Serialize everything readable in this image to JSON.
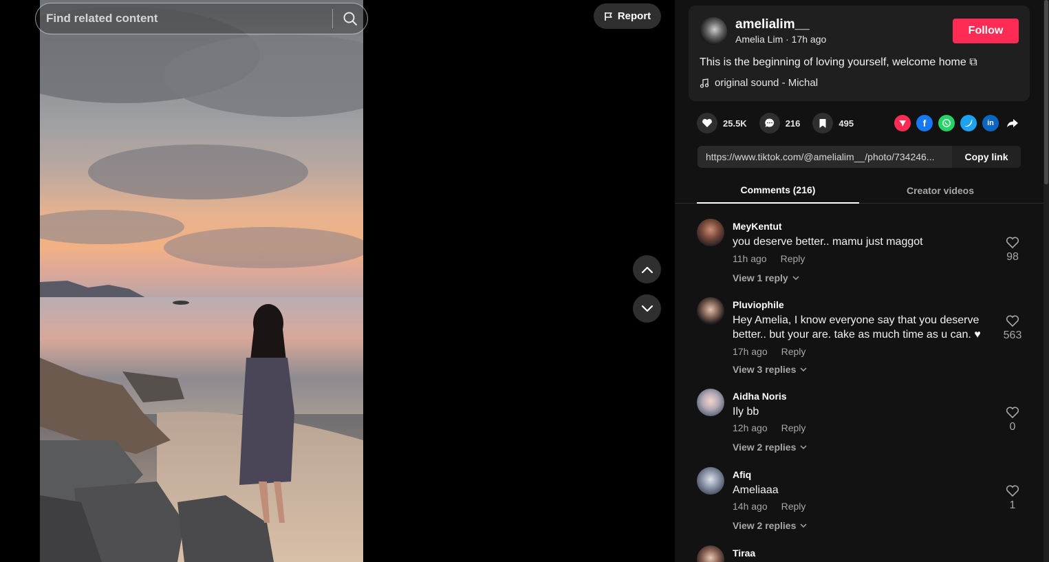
{
  "search": {
    "placeholder": "Find related content"
  },
  "report": {
    "label": "Report"
  },
  "author": {
    "handle": "amelialim__",
    "meta": "Amelia Lim · 17h ago",
    "follow_label": "Follow",
    "caption": "This is the beginning of loving yourself, welcome home ⧉",
    "sound": "original sound - Michal"
  },
  "actions": {
    "likes": "25.5K",
    "comments": "216",
    "saves": "495"
  },
  "share": {
    "url": "https://www.tiktok.com/@amelialim__/photo/734246...",
    "copy_label": "Copy link",
    "colors": {
      "tiktok": "#fe2c55",
      "facebook": "#1877f2",
      "whatsapp": "#25d366",
      "twitter": "#1da1f2",
      "linkedin": "#0a66c2"
    }
  },
  "tabs": {
    "comments": "Comments (216)",
    "creator": "Creator videos"
  },
  "comments": [
    {
      "user": "MeyKentut",
      "text": "you deserve better.. mamu just maggot",
      "time": "11h ago",
      "reply": "Reply",
      "view": "View 1 reply",
      "likes": "98"
    },
    {
      "user": "Pluviophile",
      "text": "Hey Amelia, I know everyone say that you deserve better.. but your are. take as much time as u can. ♥",
      "time": "17h ago",
      "reply": "Reply",
      "view": "View 3 replies",
      "likes": "563"
    },
    {
      "user": "Aidha Noris",
      "text": "Ily bb",
      "time": "12h ago",
      "reply": "Reply",
      "view": "View 2 replies",
      "likes": "0"
    },
    {
      "user": "Afiq",
      "text": "Ameliaaa",
      "time": "14h ago",
      "reply": "Reply",
      "view": "View 2 replies",
      "likes": "1"
    },
    {
      "user": "Tiraa"
    }
  ]
}
